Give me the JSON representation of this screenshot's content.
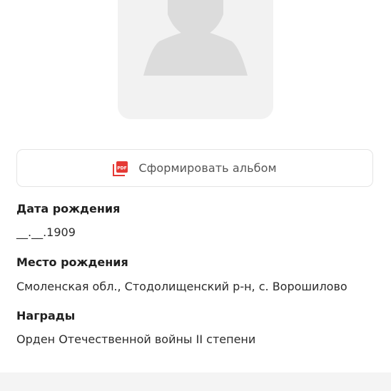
{
  "album_button": {
    "label": "Сформировать альбом",
    "icon": "pdf-icon",
    "icon_color": "#e53935"
  },
  "fields": {
    "birth_date": {
      "title": "Дата рождения",
      "value": "__.__.1909"
    },
    "birth_place": {
      "title": "Место рождения",
      "value": "Смоленская обл., Стодолищенский р-н, с. Ворошилово"
    },
    "awards": {
      "title": "Награды",
      "value": "Орден Отечественной войны II степени"
    }
  },
  "colors": {
    "placeholder_bg": "#f2f2f2",
    "silhouette": "#dcdcdc",
    "footer": "#f4f4f4"
  }
}
